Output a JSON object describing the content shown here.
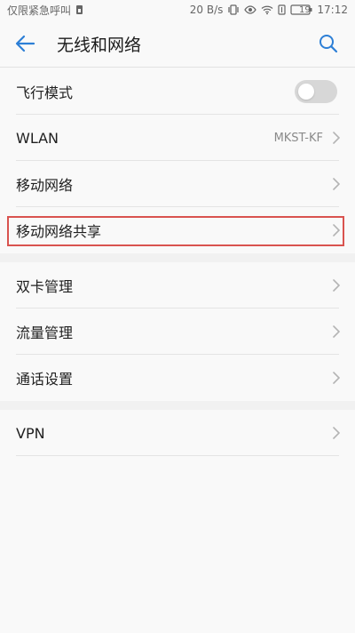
{
  "status_bar": {
    "emergency_text": "仅限紧急呼叫",
    "network_speed": "20 B/s",
    "battery_level": "19",
    "time": "17:12"
  },
  "header": {
    "title": "无线和网络"
  },
  "rows": [
    {
      "label": "飞行模式"
    },
    {
      "label": "WLAN",
      "value": "MKST-KF"
    },
    {
      "label": "移动网络"
    },
    {
      "label": "移动网络共享"
    },
    {
      "label": "双卡管理"
    },
    {
      "label": "流量管理"
    },
    {
      "label": "通话设置"
    },
    {
      "label": "VPN"
    }
  ],
  "colors": {
    "accent": "#2d7fd6",
    "highlight": "#d9534f",
    "toggle_off": "#d7d7d7"
  },
  "icons": {
    "back": "arrow-left-icon",
    "search": "search-icon",
    "chevron": "chevron-right-icon"
  }
}
